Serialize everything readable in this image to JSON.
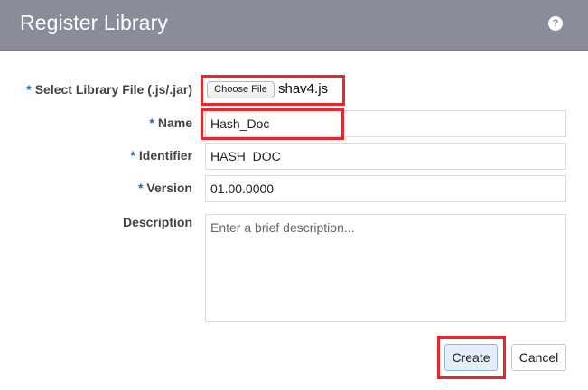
{
  "dialog": {
    "title": "Register Library",
    "help_icon": "?"
  },
  "form": {
    "required_marker": "*",
    "file": {
      "label": "Select Library File (.js/.jar)",
      "button_label": "Choose File",
      "file_name": "shav4.js"
    },
    "name": {
      "label": "Name",
      "value": "Hash_Doc"
    },
    "identifier": {
      "label": "Identifier",
      "value": "HASH_DOC"
    },
    "version": {
      "label": "Version",
      "value": "01.00.0000"
    },
    "description": {
      "label": "Description",
      "placeholder": "Enter a brief description..."
    }
  },
  "actions": {
    "create_label": "Create",
    "cancel_label": "Cancel"
  },
  "colors": {
    "header": "#8a8d99",
    "required": "#1b6ea8",
    "highlight": "#e8262c"
  }
}
